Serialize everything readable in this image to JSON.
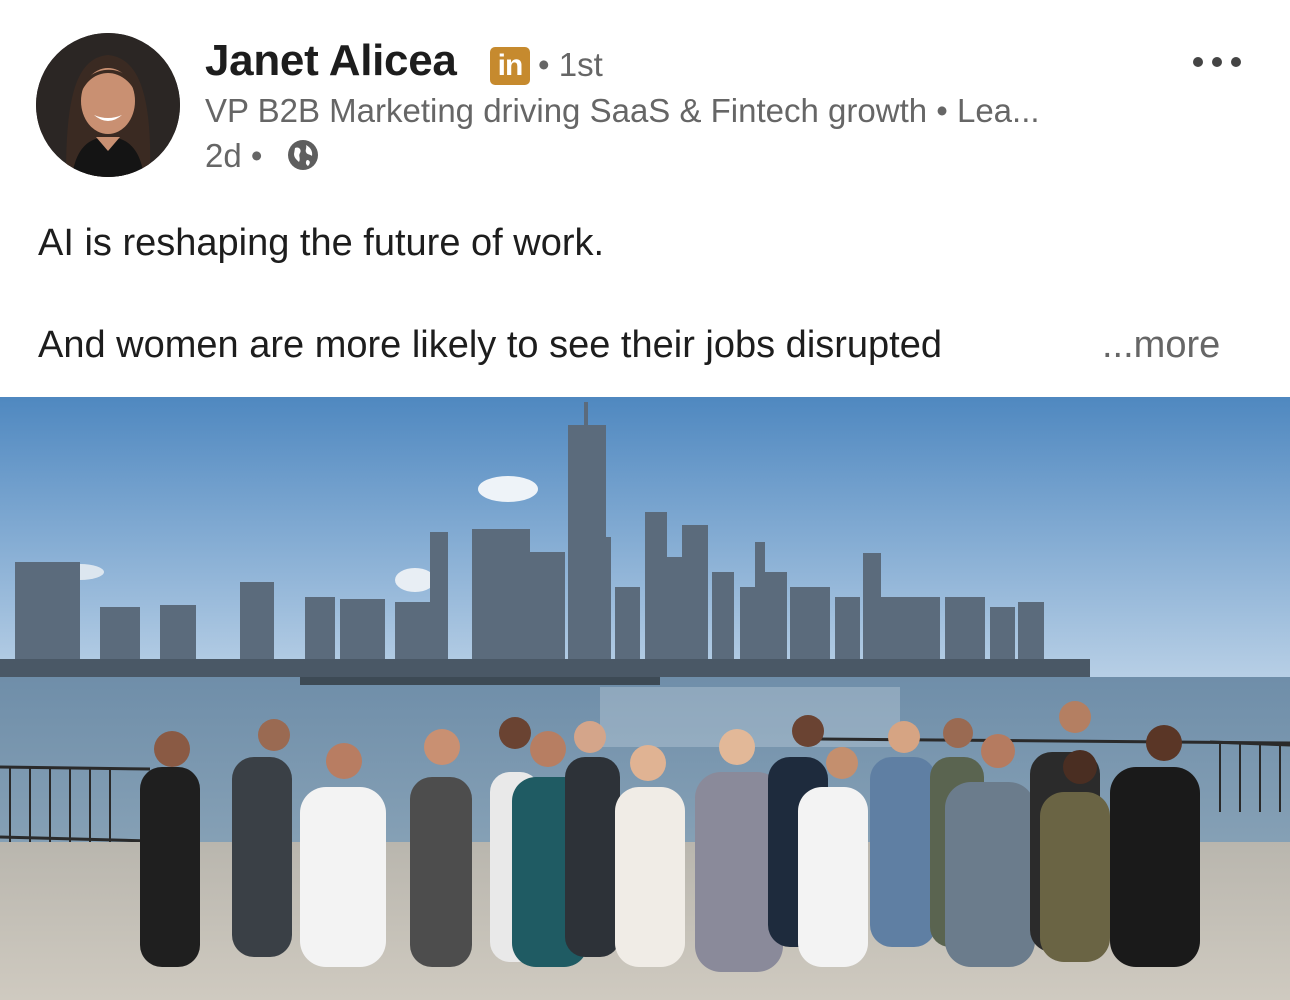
{
  "post": {
    "author": {
      "name": "Janet Alicea",
      "badge": "in",
      "connection": "• 1st",
      "headline": "VP B2B Marketing driving SaaS & Fintech growth • Lea...",
      "timestamp": "2d •",
      "visibility_icon": "globe-icon"
    },
    "menu_icon": "more-options-icon",
    "text_line_1": "AI is reshaping the future of work.",
    "text_line_2": "And women are more likely to see their jobs disrupted",
    "see_more": "...more",
    "image": {
      "subject": "group-photo-on-waterfront-with-city-skyline"
    }
  },
  "colors": {
    "text_primary": "#1d1d1d",
    "text_secondary": "#666666",
    "linkedin_badge": "#c68a2e",
    "sky": "#6f9fc9",
    "water": "#7f9cb4"
  }
}
